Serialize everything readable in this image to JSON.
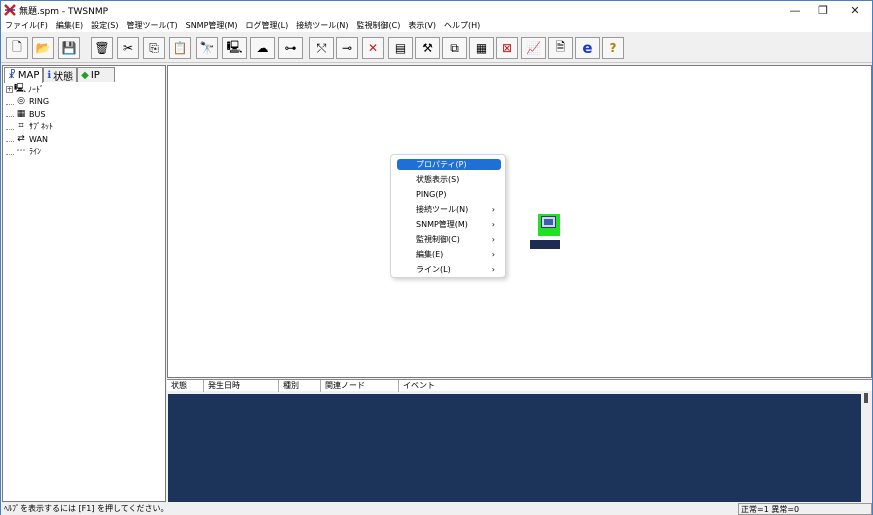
{
  "window": {
    "title": "無題.spm - TWSNMP",
    "controls": {
      "minimize": "—",
      "maximize": "❐",
      "close": "✕"
    }
  },
  "menubar": {
    "items": [
      {
        "label": "ファイル(F)"
      },
      {
        "label": "編集(E)"
      },
      {
        "label": "設定(S)"
      },
      {
        "label": "管理ツール(T)"
      },
      {
        "label": "SNMP管理(M)"
      },
      {
        "label": "ログ管理(L)"
      },
      {
        "label": "接続ツール(N)"
      },
      {
        "label": "監視制御(C)"
      },
      {
        "label": "表示(V)"
      },
      {
        "label": "ヘルプ(H)"
      }
    ]
  },
  "toolbar": {
    "buttons": [
      {
        "icon": "new-file-icon",
        "glyph": "🗋"
      },
      {
        "icon": "open-folder-icon",
        "glyph": "📂"
      },
      {
        "icon": "save-icon",
        "glyph": "💾"
      },
      {
        "icon": "trash-icon",
        "glyph": "🗑"
      },
      {
        "icon": "cut-icon",
        "glyph": "✂"
      },
      {
        "icon": "copy-icon",
        "glyph": "⎘"
      },
      {
        "icon": "paste-icon",
        "glyph": "📋"
      },
      {
        "icon": "find-icon",
        "glyph": "🔭"
      },
      {
        "icon": "add-node-icon",
        "glyph": "🖳"
      },
      {
        "icon": "add-cloud-icon",
        "glyph": "☁"
      },
      {
        "icon": "add-line-icon",
        "glyph": "⊶"
      },
      {
        "icon": "connect-line-icon",
        "glyph": "⤲"
      },
      {
        "icon": "connector-icon",
        "glyph": "⊸"
      },
      {
        "icon": "delete-icon",
        "glyph": "✕"
      },
      {
        "icon": "node-list-icon",
        "glyph": "▤"
      },
      {
        "icon": "map-tool-icon",
        "glyph": "⚒"
      },
      {
        "icon": "poll-icon",
        "glyph": "⧉"
      },
      {
        "icon": "report-icon",
        "glyph": "▦"
      },
      {
        "icon": "stop-icon",
        "glyph": "⊠"
      },
      {
        "icon": "graph-icon",
        "glyph": "📈"
      },
      {
        "icon": "log-icon",
        "glyph": "🗎"
      },
      {
        "icon": "browser-e-icon",
        "glyph": "e"
      },
      {
        "icon": "help-icon",
        "glyph": "?"
      }
    ]
  },
  "left_pane": {
    "tabs": [
      {
        "label": "MAP",
        "icon": "map-tab-icon",
        "glyph": "☧"
      },
      {
        "label": "状態",
        "icon": "info-tab-icon",
        "glyph": "ℹ"
      },
      {
        "label": "IP",
        "icon": "ip-tab-icon",
        "glyph": "◆"
      }
    ],
    "tree": [
      {
        "label": "ﾉｰﾄﾞ",
        "icon": "node-icon",
        "expander": "+"
      },
      {
        "label": "RING",
        "icon": "ring-icon"
      },
      {
        "label": "BUS",
        "icon": "bus-icon"
      },
      {
        "label": "ｻﾌﾞﾈｯﾄ",
        "icon": "subnet-icon"
      },
      {
        "label": "WAN",
        "icon": "wan-icon"
      },
      {
        "label": "ﾗｲﾝ",
        "icon": "line-icon"
      }
    ]
  },
  "context_menu": {
    "items": [
      {
        "label": "プロパティ(P)",
        "selected": true,
        "submenu": false
      },
      {
        "label": "状態表示(S)",
        "submenu": false
      },
      {
        "label": "PING(P)",
        "submenu": false
      },
      {
        "label": "接続ツール(N)",
        "submenu": true
      },
      {
        "label": "SNMP管理(M)",
        "submenu": true
      },
      {
        "label": "監視制御(C)",
        "submenu": true
      },
      {
        "label": "編集(E)",
        "submenu": true
      },
      {
        "label": "ライン(L)",
        "submenu": true
      }
    ],
    "submenu_arrow": "›"
  },
  "event_log": {
    "columns": [
      {
        "label": "状態"
      },
      {
        "label": "発生日時"
      },
      {
        "label": "種別"
      },
      {
        "label": "関連ノード"
      },
      {
        "label": "イベント"
      }
    ]
  },
  "statusbar": {
    "help_text": "ﾍﾙﾌﾟを表示するには [F1] を押してください。",
    "counter_text": "正常=1 異常=0"
  },
  "colors": {
    "node_background": "#22e022",
    "event_list_background": "#1c3459",
    "menu_selection": "#1e6fd6"
  }
}
